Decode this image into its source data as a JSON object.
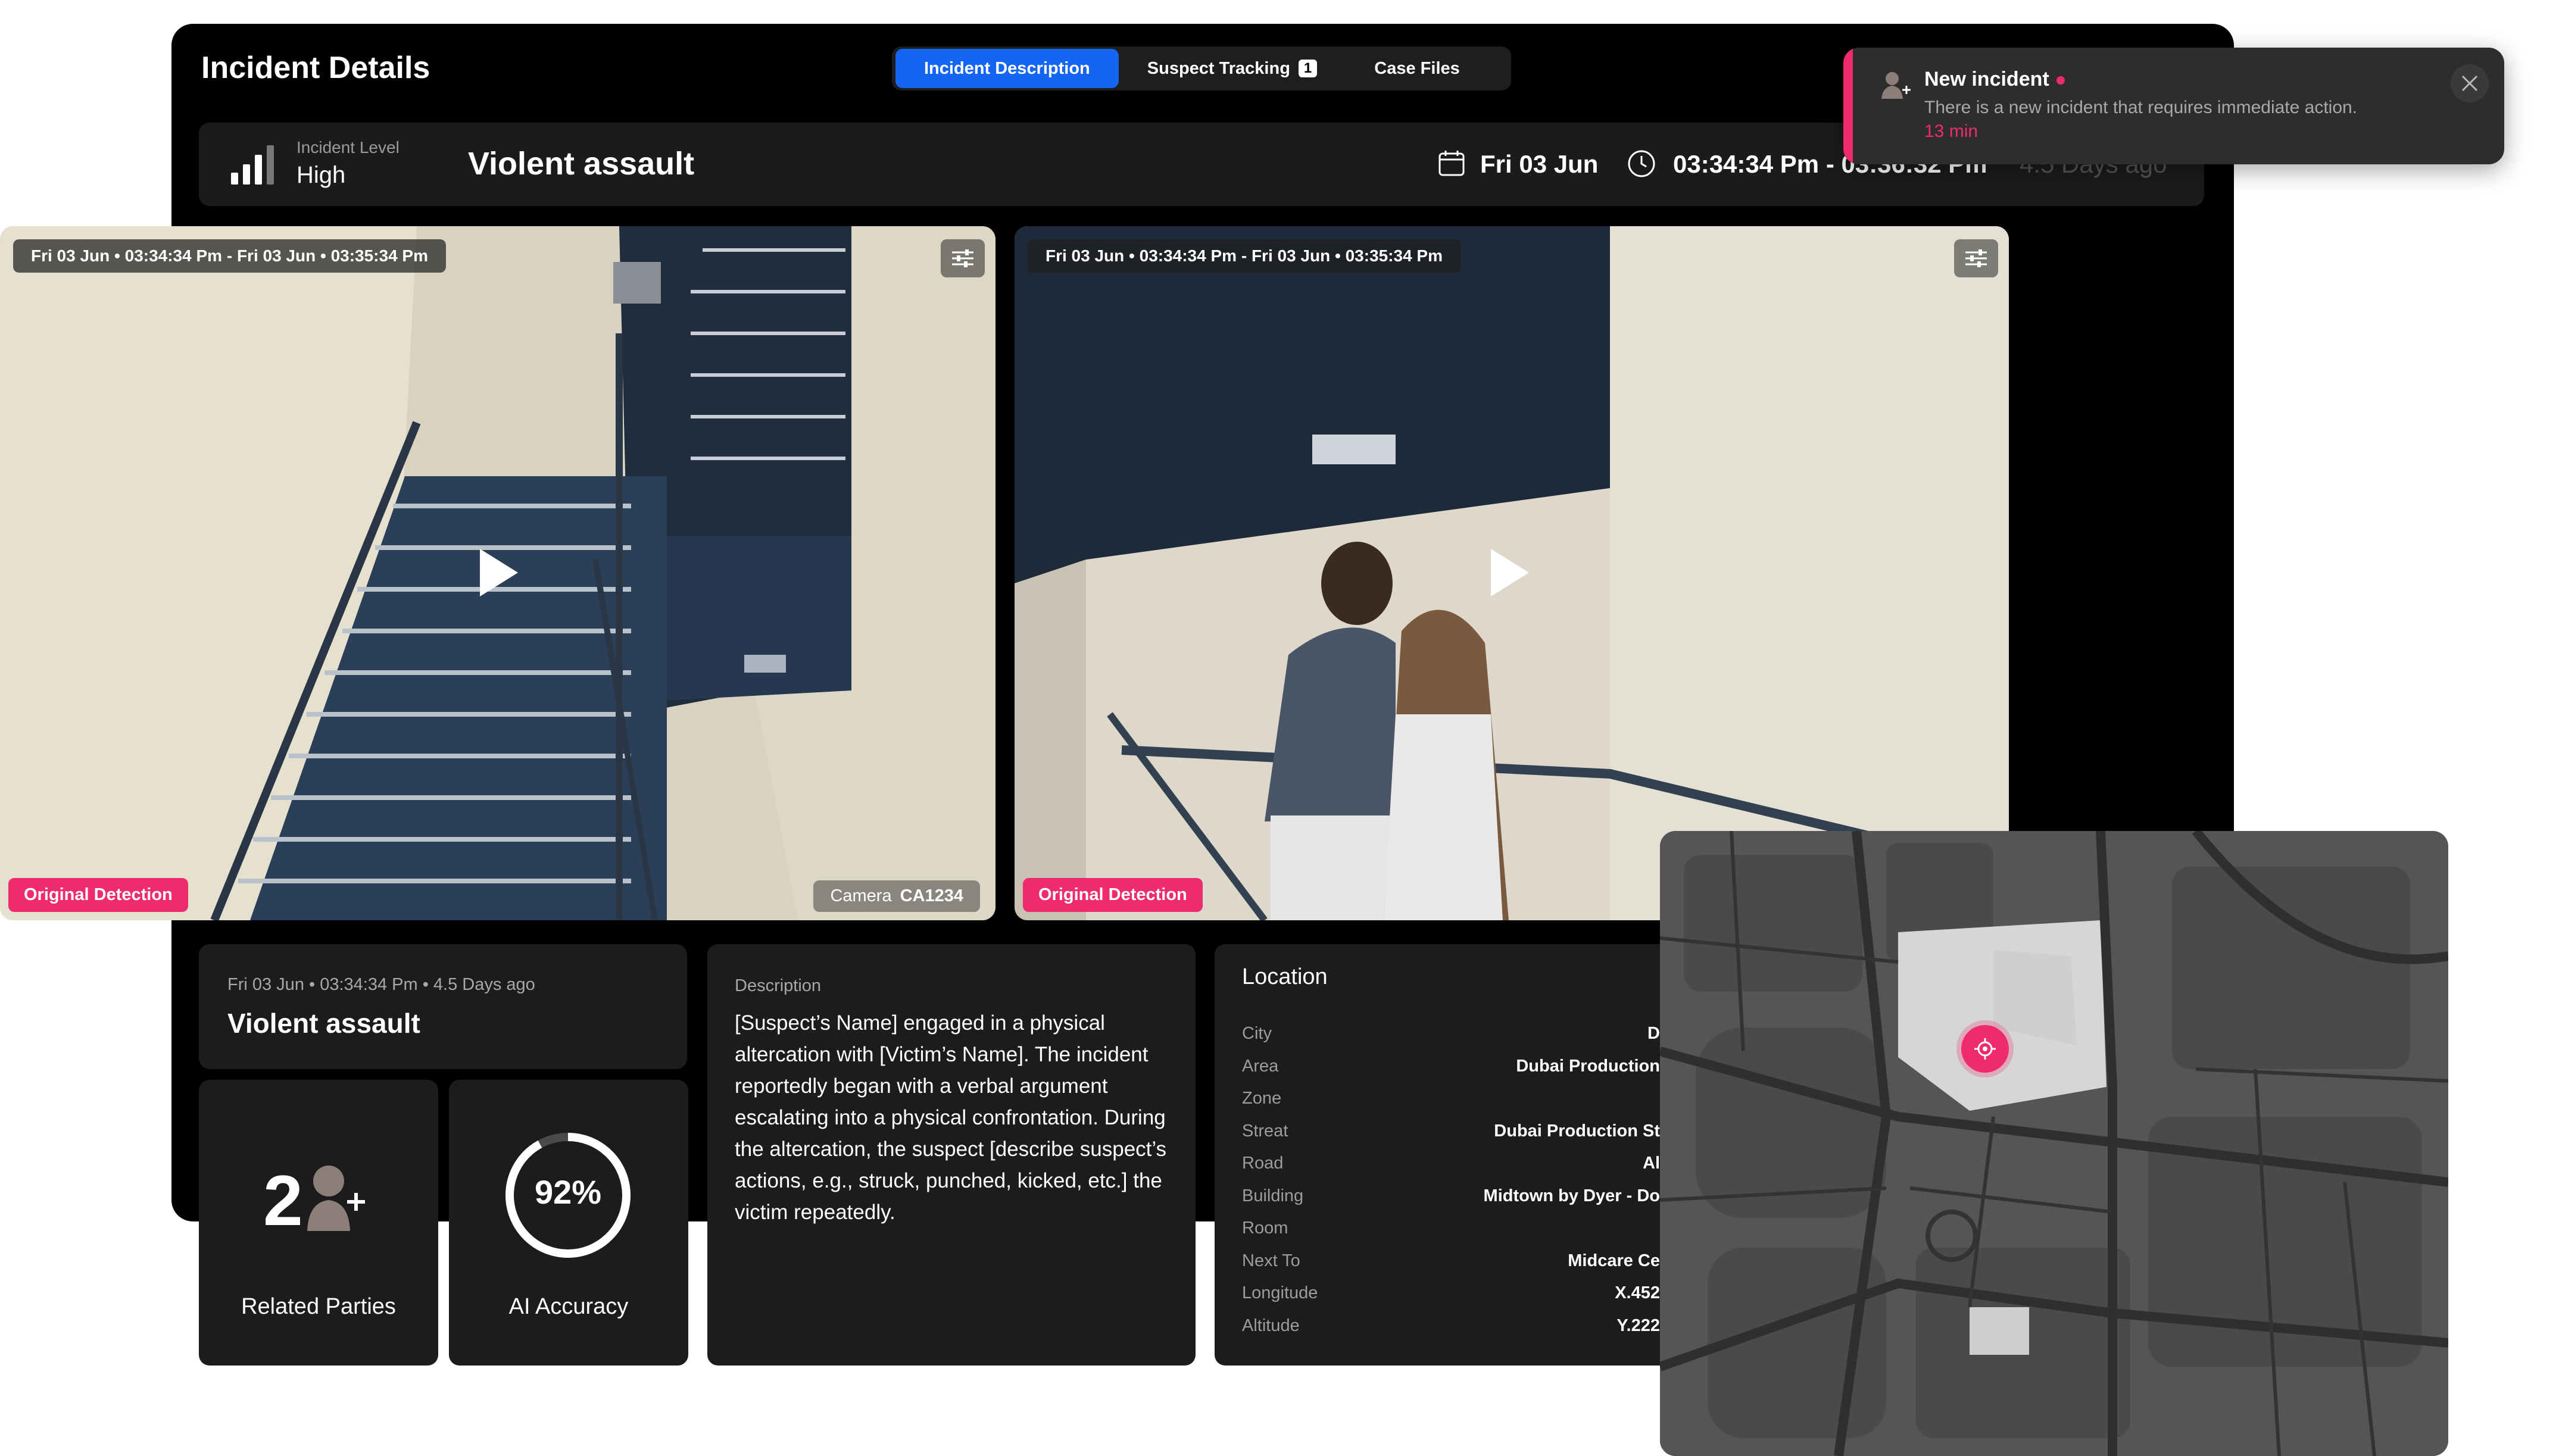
{
  "header": {
    "title": "Incident Details",
    "tabs": [
      {
        "label": "Incident Description",
        "active": true
      },
      {
        "label": "Suspect Tracking",
        "badge": "1",
        "active": false
      },
      {
        "label": "Case Files",
        "active": false
      }
    ]
  },
  "incident": {
    "level_label": "Incident Level",
    "level_value": "High",
    "type": "Violent assault",
    "date": "Fri 03 Jun",
    "time_range": "03:34:34 Pm - 03:36:32 Pm",
    "ago": "4.5 Days ago"
  },
  "videos": [
    {
      "timestamp": "Fri 03 Jun • 03:34:34 Pm - Fri 03 Jun • 03:35:34 Pm",
      "badge": "Original Detection",
      "camera_label": "Camera",
      "camera_id": "CA1234"
    },
    {
      "timestamp": "Fri 03 Jun • 03:34:34 Pm - Fri 03 Jun • 03:35:34 Pm",
      "badge": "Original Detection"
    }
  ],
  "summary": {
    "meta": "Fri 03 Jun • 03:34:34 Pm • 4.5 Days ago",
    "title": "Violent assault"
  },
  "stats": {
    "related_parties_count": "2",
    "related_parties_label": "Related Parties",
    "ai_accuracy_value": "92%",
    "ai_accuracy_fraction": 0.92,
    "ai_accuracy_label": "AI Accuracy"
  },
  "description": {
    "label": "Description",
    "text": "[Suspect’s Name] engaged in a physical altercation with [Victim’s Name]. The incident reportedly began with a verbal argument escalating into a physical confrontation. During the altercation, the suspect [describe suspect’s actions, e.g., struck, punched, kicked, etc.] the victim repeatedly."
  },
  "location": {
    "title": "Location",
    "rows": [
      {
        "label": "City",
        "value": "D"
      },
      {
        "label": "Area",
        "value": "Dubai Production"
      },
      {
        "label": "Zone",
        "value": ""
      },
      {
        "label": "Streat",
        "value": "Dubai Production St"
      },
      {
        "label": "Road",
        "value": "Al"
      },
      {
        "label": "Building",
        "value": "Midtown by Dyer - Do"
      },
      {
        "label": "Room",
        "value": ""
      },
      {
        "label": "Next To",
        "value": "Midcare Ce"
      },
      {
        "label": "Longitude",
        "value": "X.452"
      },
      {
        "label": "Altitude",
        "value": "Y.222"
      }
    ]
  },
  "toast": {
    "title": "New incident",
    "message": "There is a new incident that requires immediate action.",
    "time": "13 min"
  },
  "colors": {
    "accent_blue": "#1565f5",
    "accent_pink": "#ef2a6d",
    "panel": "#000000",
    "card": "#1c1c1c"
  }
}
